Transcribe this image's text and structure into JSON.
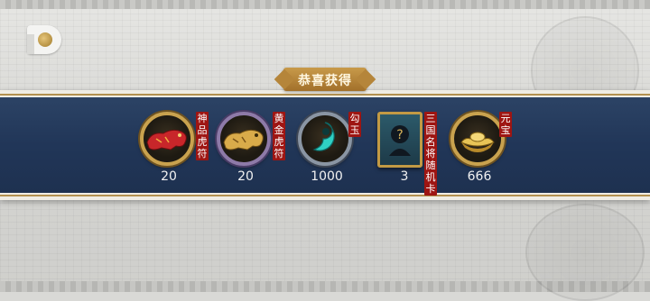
{
  "title": "恭喜获得",
  "rewards": [
    {
      "name": "神品虎符",
      "count": "20",
      "icon": "red-tiger-tally-icon"
    },
    {
      "name": "黄金虎符",
      "count": "20",
      "icon": "gold-tiger-tally-icon"
    },
    {
      "name": "勾玉",
      "count": "1000",
      "icon": "magatama-jade-icon"
    },
    {
      "name": "三国名将随机卡",
      "count": "3",
      "icon": "mystery-general-card-icon"
    },
    {
      "name": "元宝",
      "count": "666",
      "icon": "gold-ingot-icon"
    }
  ],
  "colors": {
    "banner": "#213658",
    "gold_border": "#c9a24e",
    "tag_red": "#9e1512"
  }
}
